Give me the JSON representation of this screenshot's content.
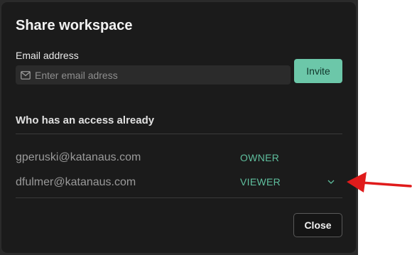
{
  "dialog": {
    "title": "Share workspace",
    "email_label": "Email address",
    "email_placeholder": "Enter email adress",
    "email_value": "",
    "invite_label": "Invite",
    "access_heading": "Who has an access already",
    "members": [
      {
        "email": "gperuski@katanaus.com",
        "role": "OWNER"
      },
      {
        "email": "dfulmer@katanaus.com",
        "role": "VIEWER"
      }
    ],
    "close_label": "Close"
  },
  "colors": {
    "accent": "#6cc7a9",
    "role_text": "#5fbf9e",
    "annotation_arrow": "#e01b1b"
  },
  "icons": {
    "email_field": "mail-icon",
    "role_dropdown": "chevron-down-icon",
    "annotation": "red-arrow-icon"
  }
}
